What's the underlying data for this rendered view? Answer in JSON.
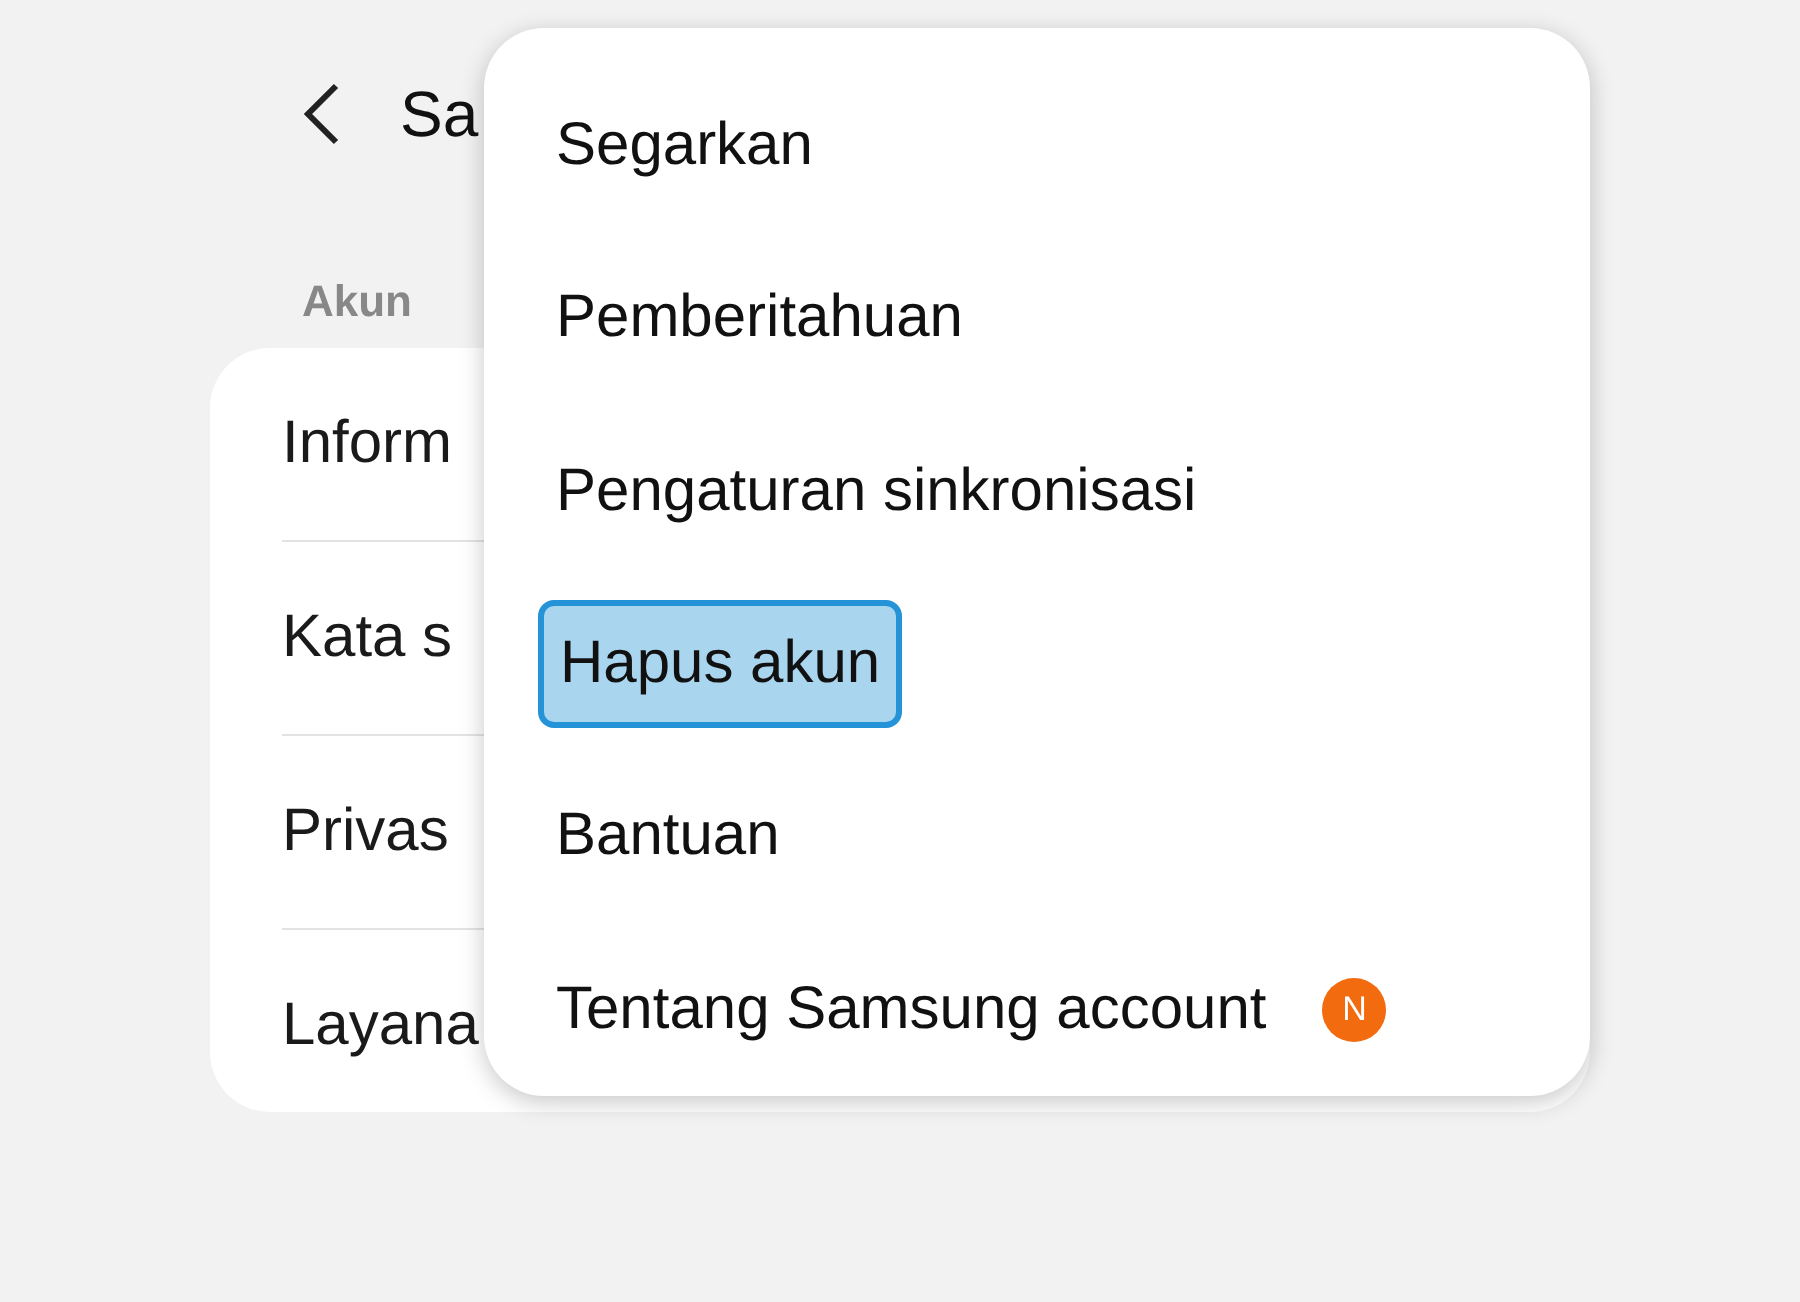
{
  "header": {
    "title": "Sa"
  },
  "section": {
    "label": "Akun"
  },
  "rows": [
    "Inform",
    "Kata s",
    "Privas",
    "Layana"
  ],
  "menu": {
    "items": [
      {
        "label": "Segarkan",
        "highlighted": false
      },
      {
        "label": "Pemberitahuan",
        "highlighted": false
      },
      {
        "label": "Pengaturan sinkronisasi",
        "highlighted": false
      },
      {
        "label": "Hapus akun",
        "highlighted": true
      },
      {
        "label": "Bantuan",
        "highlighted": false
      },
      {
        "label": "Tentang Samsung account",
        "highlighted": false,
        "badge": "N"
      }
    ]
  }
}
